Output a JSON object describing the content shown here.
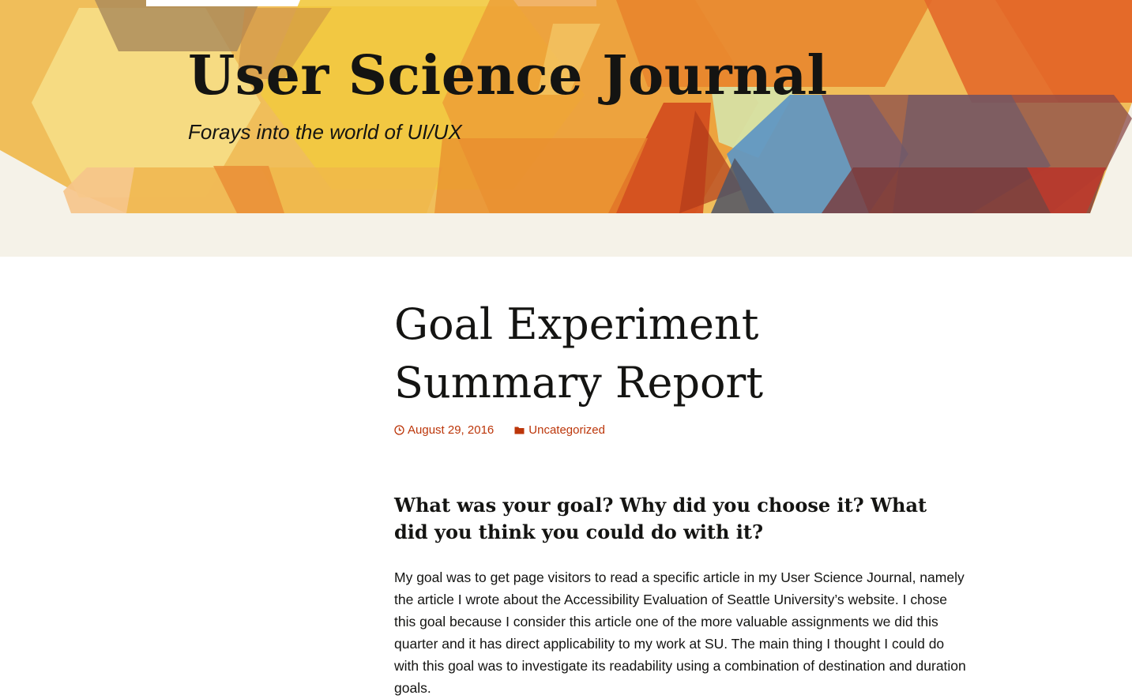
{
  "header": {
    "site_title": "User Science Journal",
    "tagline": "Forays into the world of UI/UX",
    "colors": {
      "background": "#f5f2e8",
      "yellow": "#f2c93f",
      "orange": "#e8842c",
      "red_orange": "#d0451b",
      "blue": "#5b93c4",
      "brown": "#7a3a3a"
    }
  },
  "article": {
    "title": "Goal Experiment Summary Report",
    "meta": {
      "date": "August 29, 2016",
      "date_icon": "clock-icon",
      "category": "Uncategorized",
      "category_icon": "folder-icon",
      "link_color": "#bc360a"
    },
    "section_heading": "What was your goal? Why did you choose it? What did you think you could do with it?",
    "paragraph": "My goal was to get page visitors to read a specific article in my User Science Journal, namely the article I wrote about the Accessibility Evaluation of Seattle University’s website. I chose this goal because I consider this article one of the more valuable assignments we did this quarter and it has direct applicability to my work at SU. The main thing I thought I could do with this goal was to investigate its readability using a combination of destination and duration goals."
  }
}
